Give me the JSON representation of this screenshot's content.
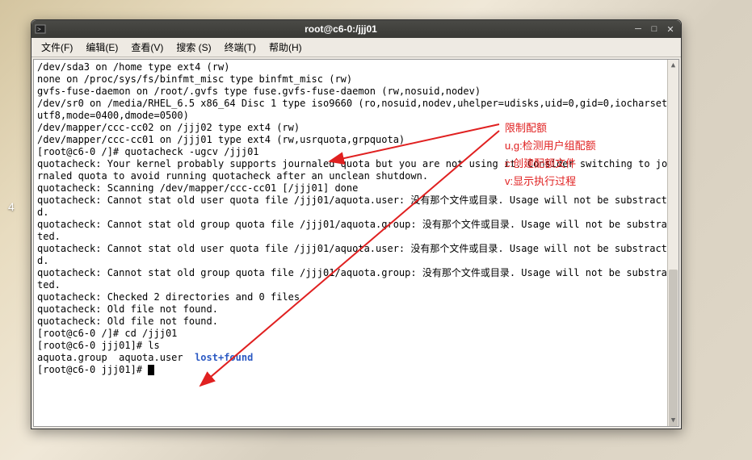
{
  "desktop": {
    "taskbar_number": "4"
  },
  "window": {
    "title": "root@c6-0:/jjj01",
    "menu": {
      "file": "文件(F)",
      "edit": "编辑(E)",
      "view": "查看(V)",
      "search": "搜索 (S)",
      "terminal": "终端(T)",
      "help": "帮助(H)"
    }
  },
  "terminal": {
    "lines": [
      "/dev/sda3 on /home type ext4 (rw)",
      "none on /proc/sys/fs/binfmt_misc type binfmt_misc (rw)",
      "gvfs-fuse-daemon on /root/.gvfs type fuse.gvfs-fuse-daemon (rw,nosuid,nodev)",
      "/dev/sr0 on /media/RHEL_6.5 x86_64 Disc 1 type iso9660 (ro,nosuid,nodev,uhelper=udisks,uid=0,gid=0,iocharset=utf8,mode=0400,dmode=0500)",
      "/dev/mapper/ccc-cc02 on /jjj02 type ext4 (rw)",
      "/dev/mapper/ccc-cc01 on /jjj01 type ext4 (rw,usrquota,grpquota)",
      "[root@c6-0 /]# quotacheck -ugcv /jjj01",
      "quotacheck: Your kernel probably supports journaled quota but you are not using it. Consider switching to journaled quota to avoid running quotacheck after an unclean shutdown.",
      "quotacheck: Scanning /dev/mapper/ccc-cc01 [/jjj01] done",
      "quotacheck: Cannot stat old user quota file /jjj01/aquota.user: 没有那个文件或目录. Usage will not be substracted.",
      "quotacheck: Cannot stat old group quota file /jjj01/aquota.group: 没有那个文件或目录. Usage will not be substracted.",
      "quotacheck: Cannot stat old user quota file /jjj01/aquota.user: 没有那个文件或目录. Usage will not be substracted.",
      "quotacheck: Cannot stat old group quota file /jjj01/aquota.group: 没有那个文件或目录. Usage will not be substracted.",
      "quotacheck: Checked 2 directories and 0 files",
      "quotacheck: Old file not found.",
      "quotacheck: Old file not found.",
      "[root@c6-0 /]# cd /jjj01",
      "[root@c6-0 jjj01]# ls"
    ],
    "ls_output": {
      "a": "aquota.group  aquota.user  ",
      "lost": "lost+found"
    },
    "prompt_last": "[root@c6-0 jjj01]# "
  },
  "annotations": {
    "a1": "限制配额",
    "a2": "u,g:检测用户组配额",
    "a3": "c:创建配额文件",
    "a4": "v:显示执行过程"
  }
}
